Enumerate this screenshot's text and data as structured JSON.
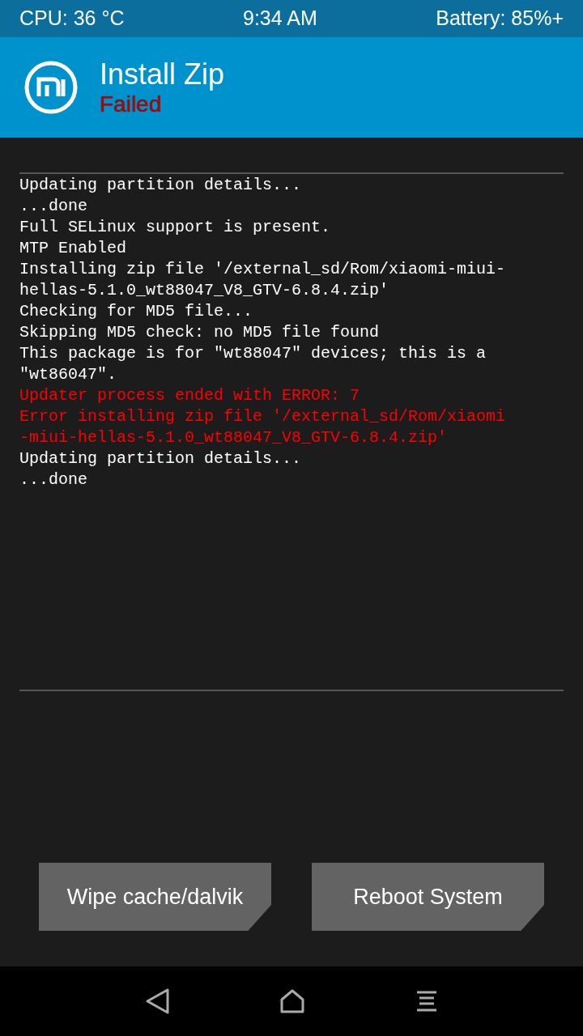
{
  "status_bar": {
    "cpu": "CPU: 36 °C",
    "time": "9:34 AM",
    "battery": "Battery: 85%+"
  },
  "header": {
    "title": "Install Zip",
    "status": "Failed",
    "failed": true
  },
  "console": [
    {
      "text": "Updating partition details...",
      "kind": "normal"
    },
    {
      "text": "...done",
      "kind": "normal"
    },
    {
      "text": "Full SELinux support is present.",
      "kind": "normal"
    },
    {
      "text": "MTP Enabled",
      "kind": "normal"
    },
    {
      "text": "Installing zip file '/external_sd/Rom/xiaomi-miui-",
      "kind": "normal"
    },
    {
      "text": "hellas-5.1.0_wt88047_V8_GTV-6.8.4.zip'",
      "kind": "normal"
    },
    {
      "text": "Checking for MD5 file...",
      "kind": "normal"
    },
    {
      "text": "Skipping MD5 check: no MD5 file found",
      "kind": "normal"
    },
    {
      "text": "This package is for \"wt88047\" devices; this is a",
      "kind": "normal"
    },
    {
      "text": "\"wt86047\".",
      "kind": "normal"
    },
    {
      "text": "Updater process ended with ERROR: 7",
      "kind": "error"
    },
    {
      "text": "Error installing zip file '/external_sd/Rom/xiaomi",
      "kind": "error"
    },
    {
      "text": "-miui-hellas-5.1.0_wt88047_V8_GTV-6.8.4.zip'",
      "kind": "error"
    },
    {
      "text": "Updating partition details...",
      "kind": "normal"
    },
    {
      "text": "...done",
      "kind": "normal"
    }
  ],
  "buttons": [
    "Wipe cache/dalvik",
    "Reboot System"
  ]
}
